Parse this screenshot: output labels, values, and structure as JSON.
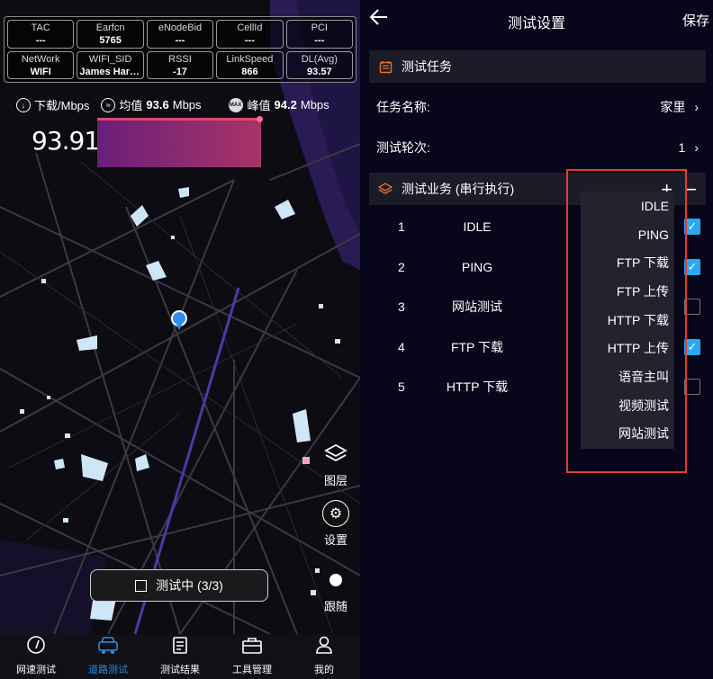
{
  "left": {
    "stats": [
      {
        "label": "TAC",
        "value": "---"
      },
      {
        "label": "Earfcn",
        "value": "5765"
      },
      {
        "label": "eNodeBid",
        "value": "---"
      },
      {
        "label": "CellId",
        "value": "---"
      },
      {
        "label": "PCI",
        "value": "---"
      },
      {
        "label": "NetWork",
        "value": "WIFI"
      },
      {
        "label": "WIFI_SID",
        "value": "James Hard..."
      },
      {
        "label": "RSSI",
        "value": "-17"
      },
      {
        "label": "LinkSpeed",
        "value": "866"
      },
      {
        "label": "DL(Avg)",
        "value": "93.57"
      }
    ],
    "download_label": "下载/Mbps",
    "avg_label": "均值",
    "avg_value": "93.6",
    "avg_unit": "Mbps",
    "peak_label": "峰值",
    "peak_value": "94.2",
    "peak_unit": "Mbps",
    "max_badge": "MAX",
    "avg_badge": "≈",
    "current_speed": "93.91",
    "layers_label": "图层",
    "settings_label": "设置",
    "follow_label": "跟随",
    "testing_status": "测试中 (3/3)",
    "nav": [
      {
        "label": "网速测试",
        "icon": "gauge-icon"
      },
      {
        "label": "道路测试",
        "icon": "car-icon"
      },
      {
        "label": "测试结果",
        "icon": "clipboard-icon"
      },
      {
        "label": "工具管理",
        "icon": "toolbox-icon"
      },
      {
        "label": "我的",
        "icon": "user-icon"
      }
    ]
  },
  "right": {
    "title": "测试设置",
    "save": "保存",
    "task_section": "测试任务",
    "task_name_label": "任务名称:",
    "task_name_value": "家里",
    "rounds_label": "测试轮次:",
    "rounds_value": "1",
    "service_section": "测试业务 (串行执行)",
    "services": [
      {
        "num": "1",
        "name": "IDLE",
        "checked": true
      },
      {
        "num": "2",
        "name": "PING",
        "checked": true
      },
      {
        "num": "3",
        "name": "网站测试",
        "checked": false
      },
      {
        "num": "4",
        "name": "FTP 下载",
        "checked": true
      },
      {
        "num": "5",
        "name": "HTTP 下载",
        "checked": false
      }
    ],
    "dropdown": [
      "IDLE",
      "PING",
      "FTP 下载",
      "FTP 上传",
      "HTTP 下载",
      "HTTP 上传",
      "语音主叫",
      "视频测试",
      "网站测试"
    ]
  },
  "colors": {
    "accent_blue": "#2c8de0",
    "checkbox_blue": "#2aa8f0",
    "highlight_red": "#e53935",
    "section_icon_orange": "#e8742a"
  }
}
